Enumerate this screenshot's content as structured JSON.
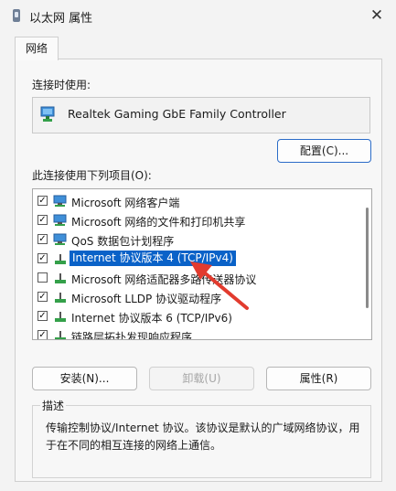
{
  "window": {
    "title": "以太网 属性",
    "close_symbol": "✕"
  },
  "tabs": [
    {
      "label": "网络"
    }
  ],
  "connect_using": {
    "label": "连接时使用:",
    "adapter": "Realtek Gaming GbE Family Controller",
    "configure_button": "配置(C)..."
  },
  "items_section": {
    "label": "此连接使用下列项目(O):",
    "items": [
      {
        "label": "Microsoft 网络客户端",
        "checked": true,
        "icon": "network-client-icon"
      },
      {
        "label": "Microsoft 网络的文件和打印机共享",
        "checked": true,
        "icon": "file-printer-sharing-icon"
      },
      {
        "label": "QoS 数据包计划程序",
        "checked": true,
        "icon": "qos-icon"
      },
      {
        "label": "Internet 协议版本 4 (TCP/IPv4)",
        "checked": true,
        "icon": "protocol-icon",
        "selected": true
      },
      {
        "label": "Microsoft 网络适配器多路传送器协议",
        "checked": false,
        "icon": "protocol-icon"
      },
      {
        "label": "Microsoft LLDP 协议驱动程序",
        "checked": true,
        "icon": "protocol-icon"
      },
      {
        "label": "Internet 协议版本 6 (TCP/IPv6)",
        "checked": true,
        "icon": "protocol-icon"
      },
      {
        "label": "链路层拓扑发现响应程序",
        "checked": true,
        "icon": "protocol-icon"
      }
    ],
    "check_mark": "✓"
  },
  "buttons": {
    "install": "安装(N)...",
    "uninstall": "卸载(U)",
    "properties": "属性(R)"
  },
  "description": {
    "title": "描述",
    "text": "传输控制协议/Internet 协议。该协议是默认的广域网络协议，用于在不同的相互连接的网络上通信。"
  },
  "colors": {
    "selection": "#0a62c8",
    "primary_border": "#2b6cc8",
    "annotation_arrow": "#e23b2e"
  }
}
